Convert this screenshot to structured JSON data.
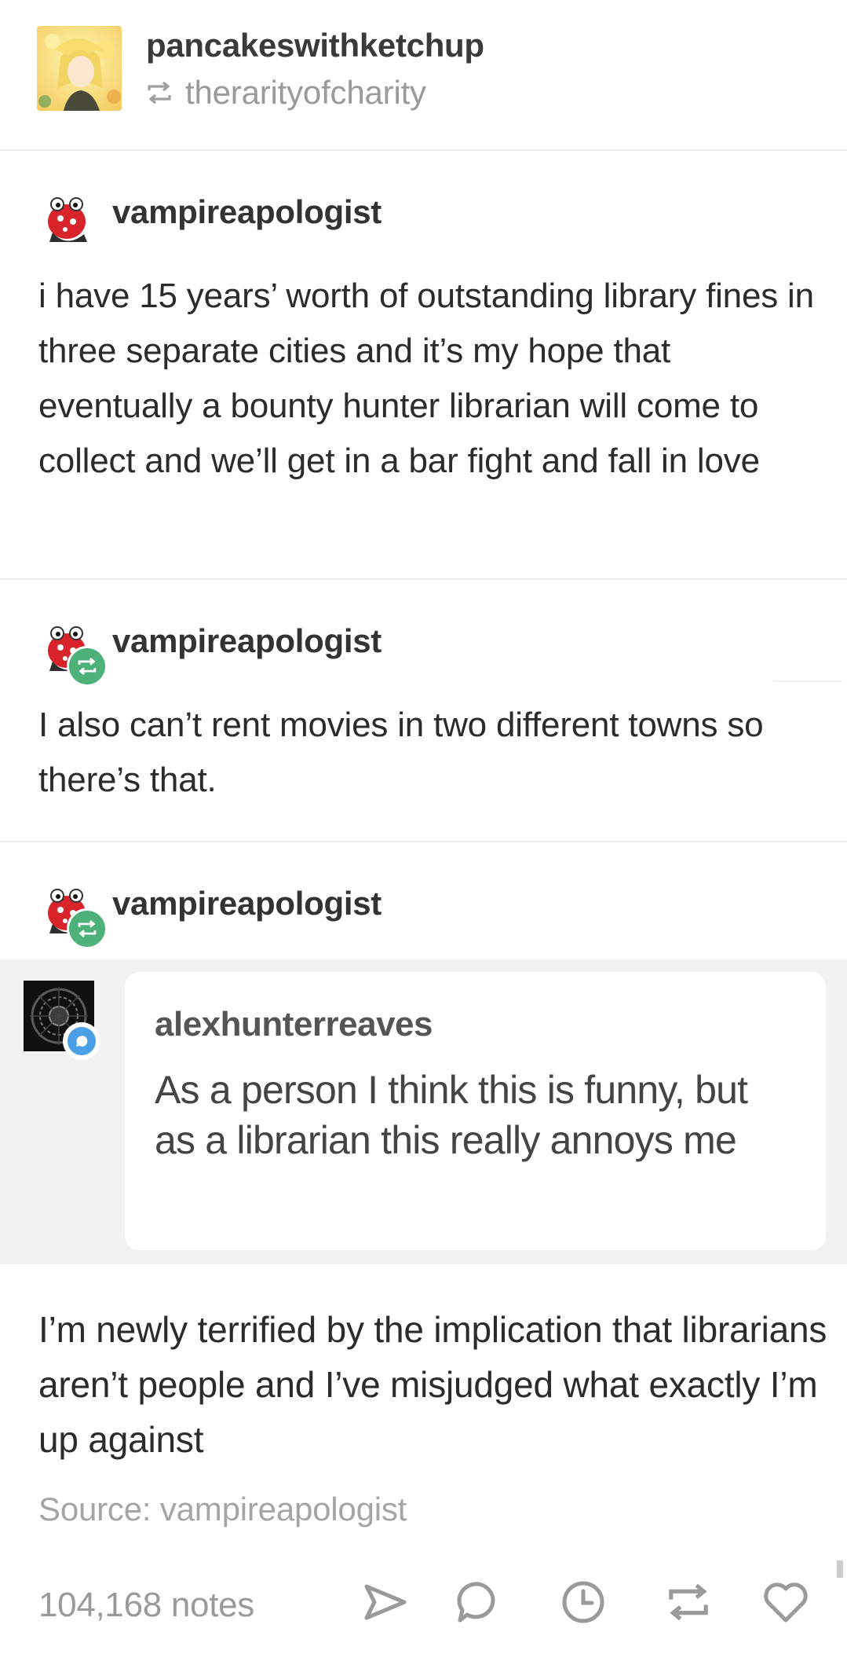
{
  "post": {
    "blog_name": "pancakeswithketchup",
    "reblogged_from": "therarityofcharity"
  },
  "thread": [
    {
      "username": "vampireapologist",
      "text": "i have 15 years’ worth of outstanding library fines in three separate cities and it’s my hope that eventually a bounty hunter librarian will come to collect and we’ll get in a bar fight and fall in love",
      "reblog_badge": false
    },
    {
      "username": "vampireapologist",
      "text": "I also can’t rent movies in two different towns so there’s that.",
      "reblog_badge": true
    },
    {
      "username": "vampireapologist",
      "reblog_badge": true,
      "ask": {
        "asker": "alexhunterreaves",
        "question": "As a person I think this is funny, but as a librarian this really annoys me"
      },
      "answer": "I’m newly terrified by the implication that librarians aren’t people and I’ve misjudged what exactly I’m up against"
    }
  ],
  "source": {
    "label": "Source:",
    "name": "vampireapologist"
  },
  "footer": {
    "notes": "104,168 notes",
    "actions": [
      "share-icon",
      "reply-icon",
      "queue-clock-icon",
      "reblog-icon",
      "like-heart-icon"
    ]
  },
  "colors": {
    "reblog_badge": "#4fb17a",
    "ask_badge": "#4a9fe6",
    "ask_background": "#f2f2f2",
    "muted_text": "#9a9a9a"
  }
}
